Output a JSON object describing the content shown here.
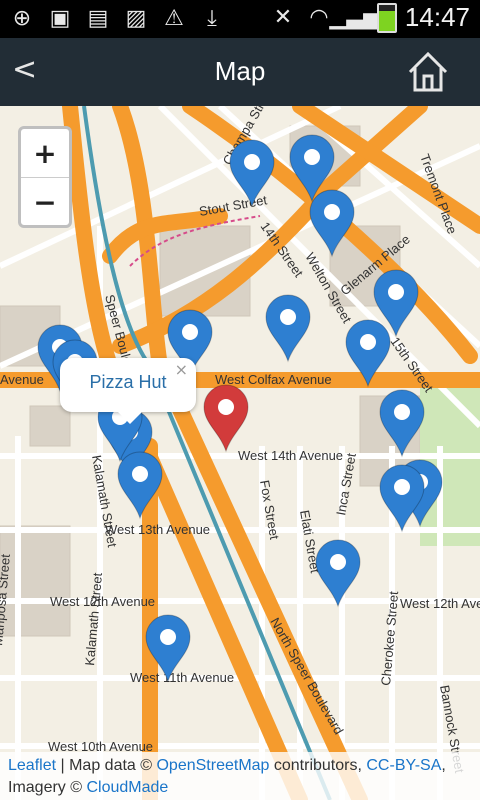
{
  "status_bar": {
    "time": "14:47",
    "icons": [
      "add-icon",
      "sim-upload-icon",
      "sd-card-icon",
      "image-icon",
      "warning-icon",
      "download-icon",
      "mute-icon",
      "wifi-icon",
      "signal-icon",
      "battery-icon"
    ]
  },
  "title_bar": {
    "title": "Map",
    "back_label": "<"
  },
  "zoom": {
    "in_label": "+",
    "out_label": "−"
  },
  "popup": {
    "label": "Pizza Hut",
    "close_label": "×"
  },
  "streets": [
    {
      "name": "Champa Street"
    },
    {
      "name": "Stout Street"
    },
    {
      "name": "14th Street"
    },
    {
      "name": "Welton Street"
    },
    {
      "name": "Glenarm Place"
    },
    {
      "name": "15th Street"
    },
    {
      "name": "Tremont Place"
    },
    {
      "name": "Speer Boulevard"
    },
    {
      "name": "West Colfax Avenue"
    },
    {
      "name": "Avenue"
    },
    {
      "name": "West 14th Avenue"
    },
    {
      "name": "Kalamath Street"
    },
    {
      "name": "West 13th Avenue"
    },
    {
      "name": "Fox Street"
    },
    {
      "name": "Elati Street"
    },
    {
      "name": "Inca Street"
    },
    {
      "name": "West 12th Avenue"
    },
    {
      "name": "West 12th Avenue"
    },
    {
      "name": "North Speer Boulevard"
    },
    {
      "name": "Cherokee Street"
    },
    {
      "name": "Bannock Street"
    },
    {
      "name": "West 11th Avenue"
    },
    {
      "name": "West 10th Avenue"
    },
    {
      "name": "Kalamath Street"
    },
    {
      "name": "Mariposa Street"
    }
  ],
  "markers": {
    "blue_count": 18,
    "red_count": 1
  },
  "attribution": {
    "leaflet": "Leaflet",
    "sep1": " | Map data © ",
    "osm": "OpenStreetMap",
    "contrib": " contributors, ",
    "license": "CC-BY-SA",
    "imagery": ", Imagery © ",
    "cloudmade": "CloudMade"
  },
  "colors": {
    "map_bg": "#f3efe4",
    "major_road": "#f59b2d",
    "minor_road": "#ffffff",
    "marker_blue": "#2e7fd1",
    "marker_red": "#d23b3b",
    "title_bar": "#222d36"
  }
}
